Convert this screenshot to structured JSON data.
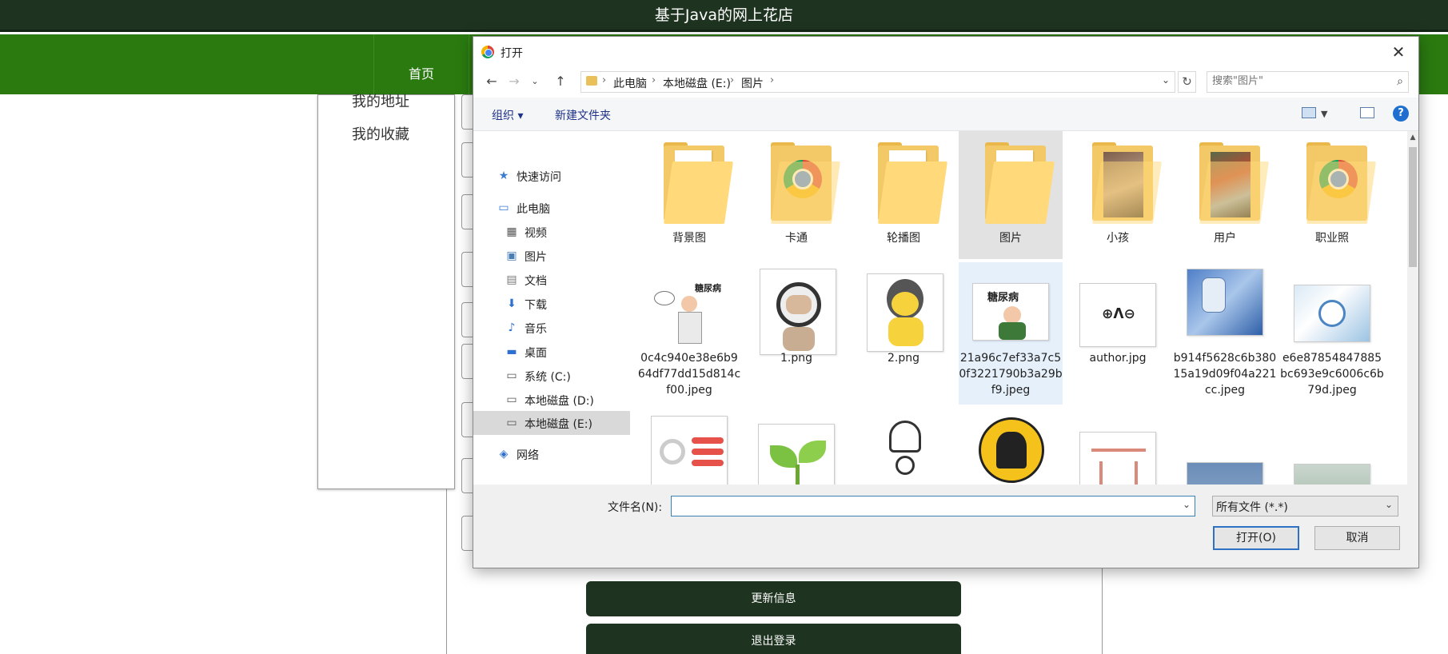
{
  "site": {
    "title": "基于Java的网上花店",
    "nav_home": "首页",
    "sidebar_links": [
      "我的地址",
      "我的收藏"
    ],
    "update_button": "更新信息",
    "logout_button": "退出登录"
  },
  "dialog": {
    "title": "打开",
    "close_symbol": "✕",
    "breadcrumb": [
      "此电脑",
      "本地磁盘 (E:)",
      "图片"
    ],
    "search_placeholder": "搜索\"图片\"",
    "toolbar": {
      "organize": "组织 ▾",
      "new_folder": "新建文件夹",
      "help": "?"
    },
    "nav_items": [
      {
        "label": "快速访问",
        "icon": "star-icon",
        "glyph": "★",
        "color": "#3a7bd5"
      },
      {
        "label": "此电脑",
        "icon": "computer-icon",
        "glyph": "🖥",
        "color": "#3a7bd5"
      },
      {
        "label": "视频",
        "icon": "video-icon",
        "glyph": "▦",
        "color": "#555555"
      },
      {
        "label": "图片",
        "icon": "pictures-icon",
        "glyph": "▣",
        "color": "#4a7fb5"
      },
      {
        "label": "文档",
        "icon": "document-icon",
        "glyph": "▤",
        "color": "#777777"
      },
      {
        "label": "下载",
        "icon": "download-icon",
        "glyph": "⬇",
        "color": "#2f6fd0"
      },
      {
        "label": "音乐",
        "icon": "music-icon",
        "glyph": "♪",
        "color": "#2f6fd0"
      },
      {
        "label": "桌面",
        "icon": "desktop-icon",
        "glyph": "▬",
        "color": "#2f6fd0"
      },
      {
        "label": "系统 (C:)",
        "icon": "drive-c-icon",
        "glyph": "▭",
        "color": "#555555"
      },
      {
        "label": "本地磁盘 (D:)",
        "icon": "drive-d-icon",
        "glyph": "▭",
        "color": "#555555"
      },
      {
        "label": "本地磁盘 (E:)",
        "icon": "drive-e-icon",
        "glyph": "▭",
        "color": "#555555"
      },
      {
        "label": "网络",
        "icon": "network-icon",
        "glyph": "◈",
        "color": "#2f6fd0"
      }
    ],
    "folders": [
      {
        "name": "背景图",
        "style": "docs"
      },
      {
        "name": "卡通",
        "style": "chrome"
      },
      {
        "name": "轮播图",
        "style": "docs"
      },
      {
        "name": "图片",
        "style": "docs"
      },
      {
        "name": "小孩",
        "style": "photo"
      },
      {
        "name": "用户",
        "style": "photo-alt"
      },
      {
        "name": "职业照",
        "style": "chrome"
      }
    ],
    "files": [
      {
        "name": "0c4c940e38e6b964df77dd15d814cf00.jpeg",
        "thumb_text": "糖尿病"
      },
      {
        "name": "1.png",
        "thumb_text": ""
      },
      {
        "name": "2.png",
        "thumb_text": ""
      },
      {
        "name": "21a96c7ef33a7c50f3221790b3a29bf9.jpeg",
        "thumb_text": "糖尿病"
      },
      {
        "name": "author.jpg",
        "thumb_text": "⊕ᐱ⊖"
      },
      {
        "name": "b914f5628c6b38015a19d09f04a221cc.jpeg",
        "thumb_text": ""
      },
      {
        "name": "e6e87854847885bc693e9c6006c6b79d.jpeg",
        "thumb_text": ""
      }
    ],
    "bottom": {
      "filename_label": "文件名(N):",
      "filename_value": "",
      "filetype": "所有文件 (*.*)",
      "open_button": "打开(O)",
      "cancel_button": "取消"
    }
  }
}
